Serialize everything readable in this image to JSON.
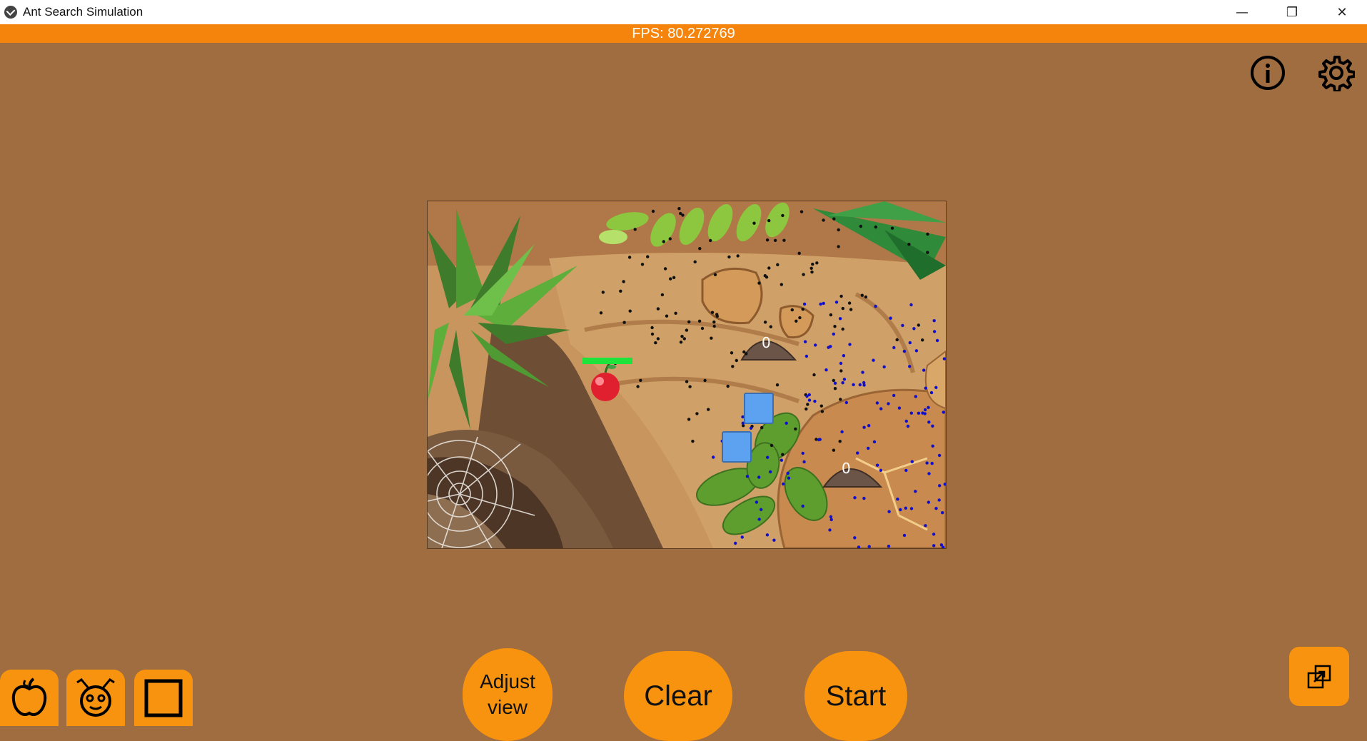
{
  "window": {
    "title": "Ant Search Simulation",
    "minimize": "—",
    "restore": "❐",
    "close": "✕"
  },
  "status": {
    "fps": "FPS: 80.272769"
  },
  "colors": {
    "background": "#A06D40",
    "accent": "#F5840C",
    "button": "#F7930F",
    "food_health": "#1EE33A",
    "obstacle": "#5DA2F0",
    "ants_colony_a": "#111111",
    "ants_colony_b": "#1010CC"
  },
  "top_icons": {
    "info": "info-icon",
    "settings": "gear-icon"
  },
  "simulation": {
    "colonies": [
      {
        "count_label": "0"
      },
      {
        "count_label": "0"
      }
    ],
    "food": {
      "icon": "apple-icon",
      "health": 1.0
    },
    "obstacle_count": 2
  },
  "tools": {
    "add_food": "apple-icon",
    "add_colony": "ant-icon",
    "add_obstacle": "square-icon"
  },
  "controls": {
    "adjust_line1": "Adjust",
    "adjust_line2": "view",
    "clear": "Clear",
    "start": "Start",
    "expand": "expand-icon"
  }
}
